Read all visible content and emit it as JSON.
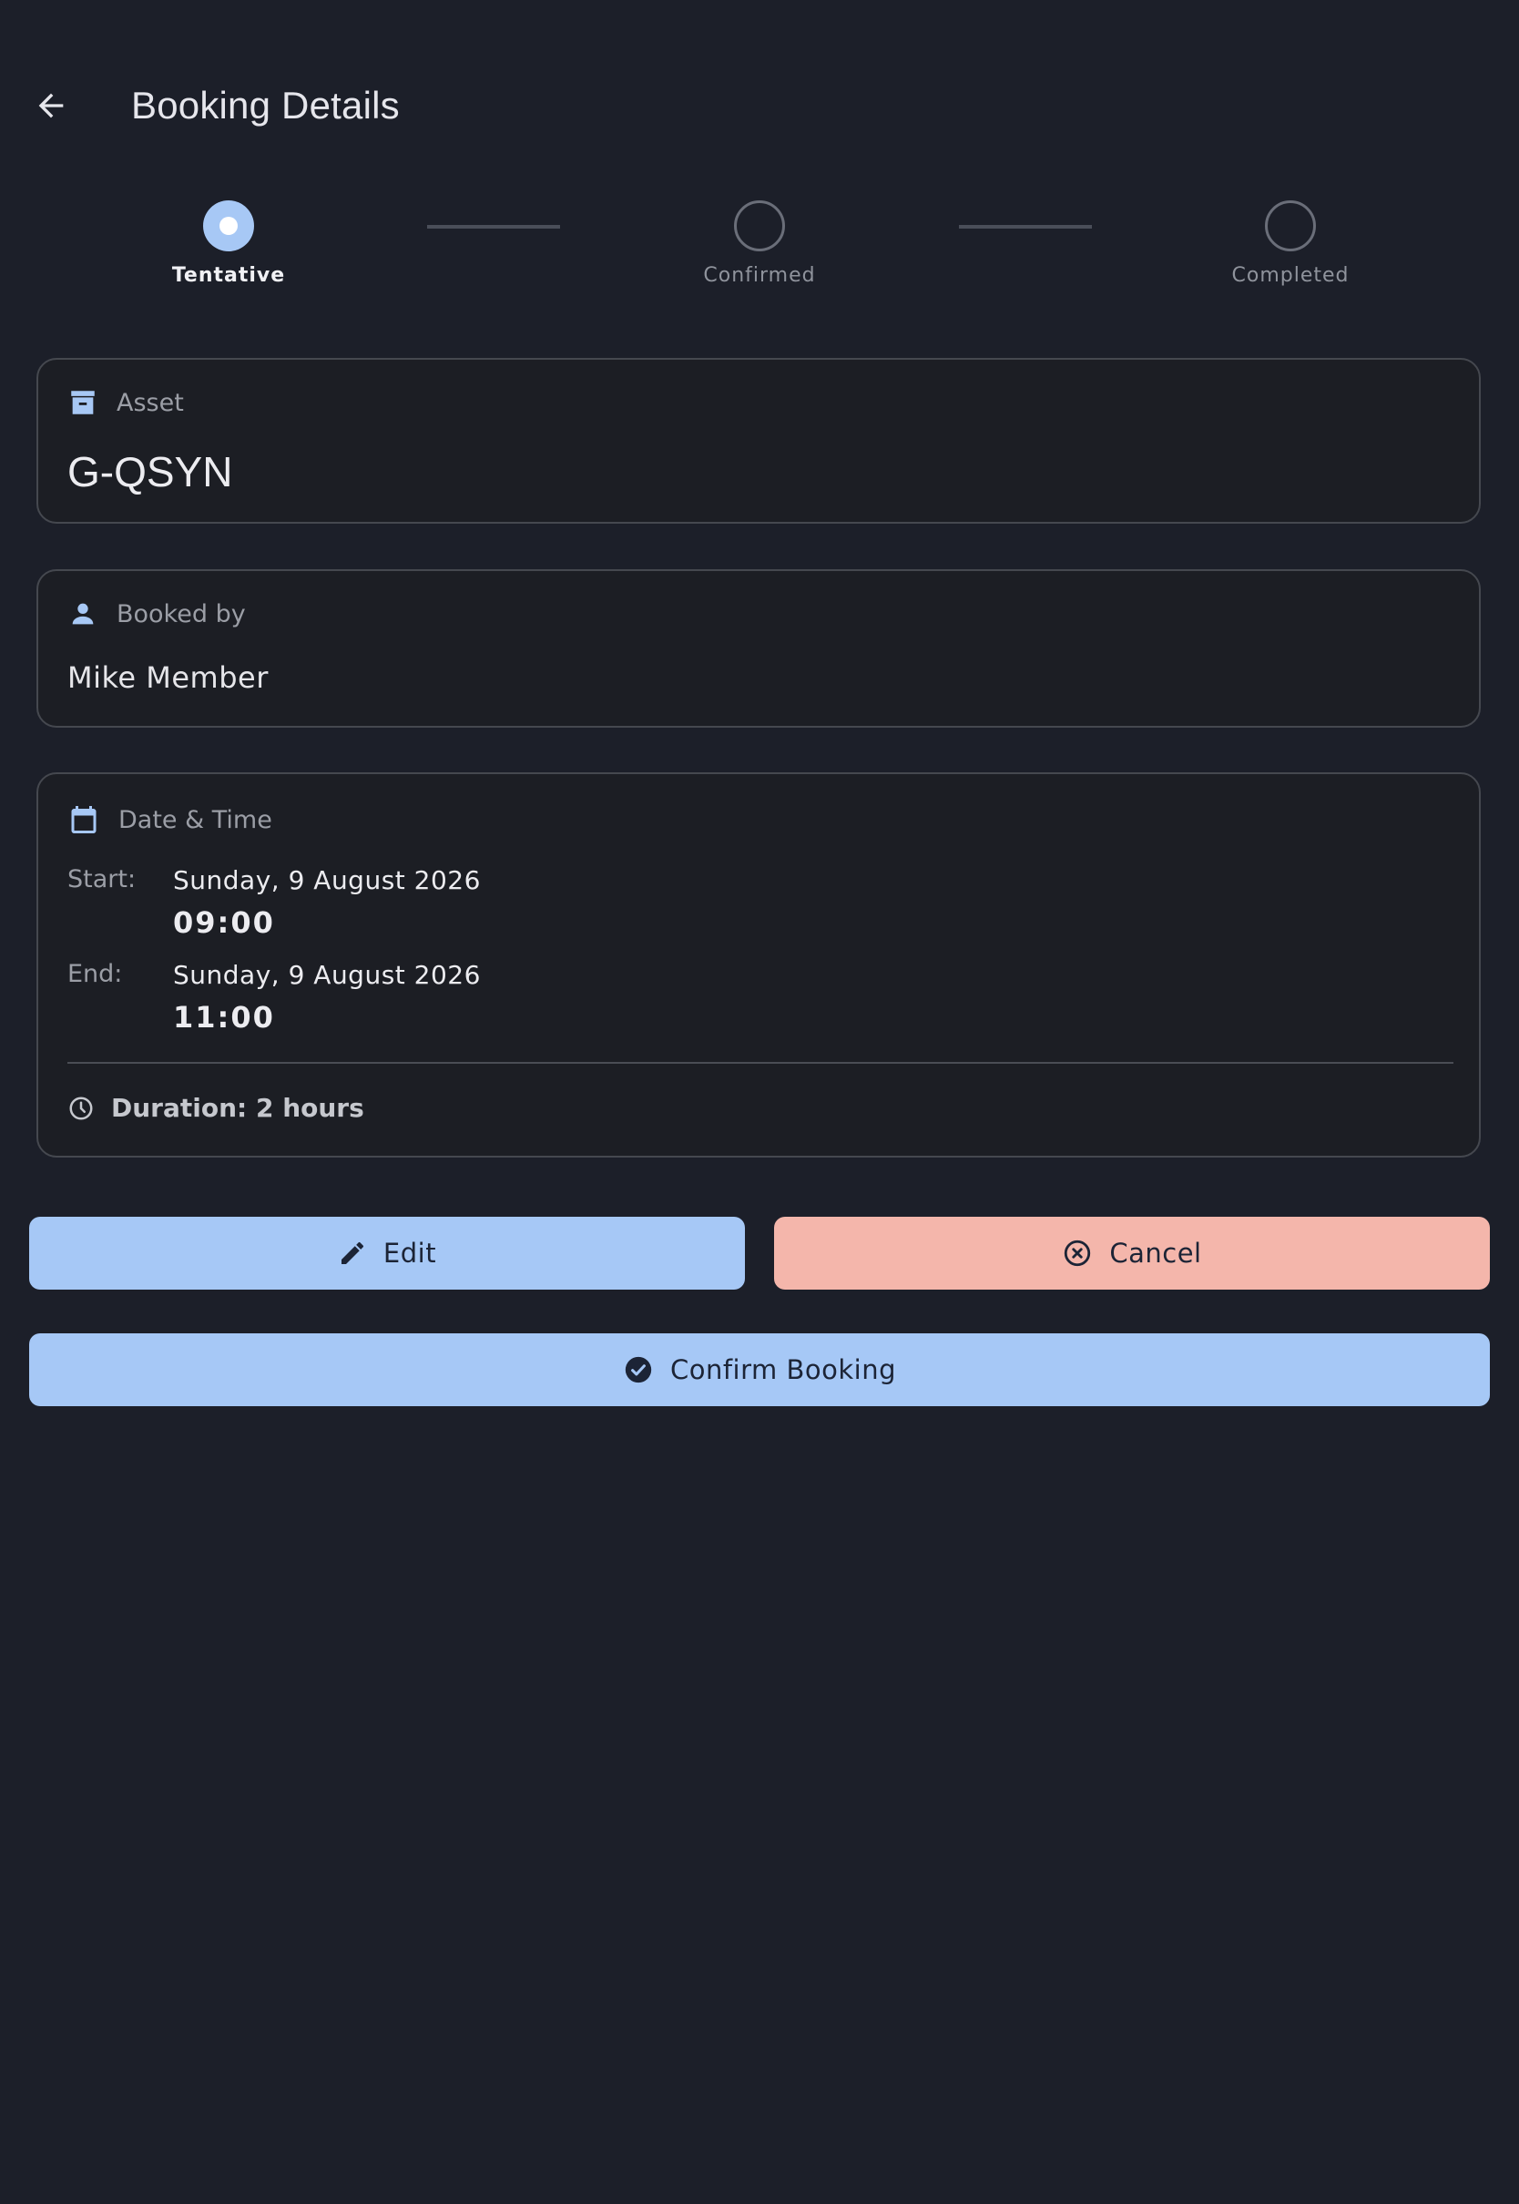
{
  "header": {
    "title": "Booking Details",
    "back_icon": "arrow-left-icon"
  },
  "stepper": {
    "steps": [
      {
        "label": "Tentative",
        "state": "active"
      },
      {
        "label": "Confirmed",
        "state": "inactive"
      },
      {
        "label": "Completed",
        "state": "inactive"
      }
    ]
  },
  "asset_card": {
    "icon": "archive-icon",
    "label": "Asset",
    "value": "G-QSYN"
  },
  "booked_by_card": {
    "icon": "person-icon",
    "label": "Booked by",
    "value": "Mike Member"
  },
  "datetime_card": {
    "icon": "calendar-icon",
    "label": "Date & Time",
    "start": {
      "key": "Start:",
      "date": "Sunday, 9 August 2026",
      "time": "09:00"
    },
    "end": {
      "key": "End:",
      "date": "Sunday, 9 August 2026",
      "time": "11:00"
    },
    "duration": "Duration: 2 hours",
    "duration_icon": "clock-icon"
  },
  "actions": {
    "edit_label": "Edit",
    "cancel_label": "Cancel",
    "confirm_label": "Confirm Booking"
  },
  "colors": {
    "background": "#1c1f29",
    "primary": "#a6c8f6",
    "danger": "#f4b6ab"
  }
}
